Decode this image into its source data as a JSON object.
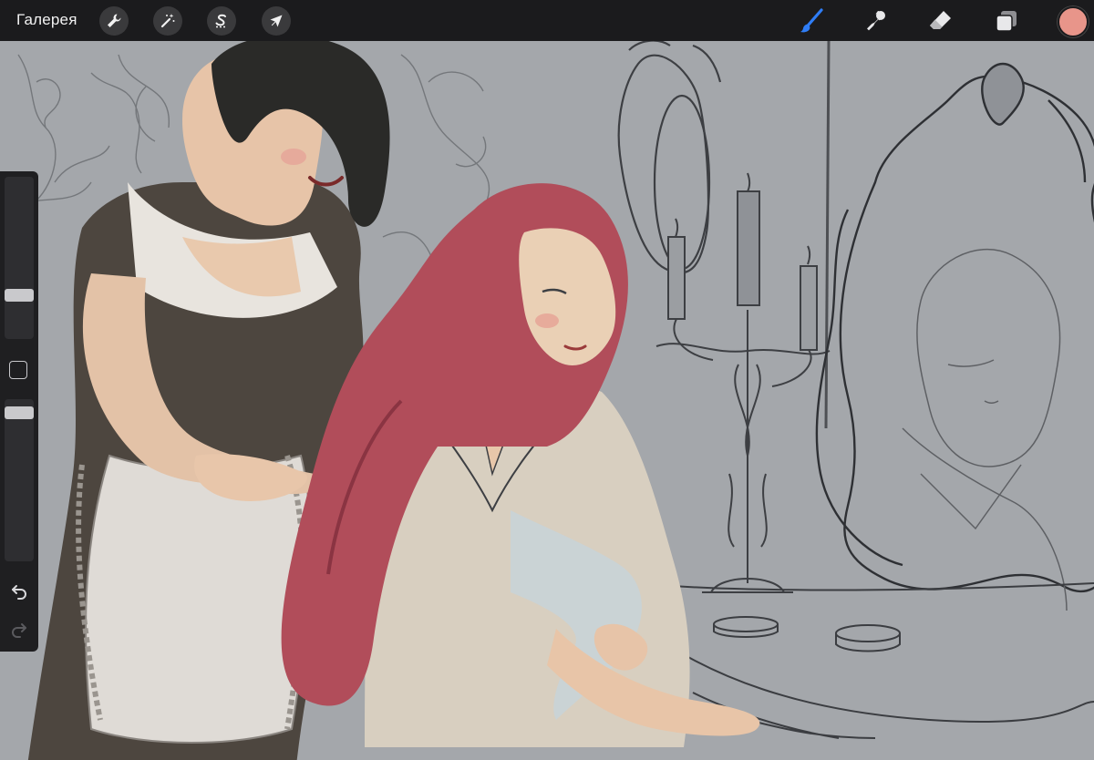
{
  "topbar": {
    "gallery_label": "Галерея",
    "left_tools": [
      {
        "name": "wrench-icon",
        "meaning": "actions"
      },
      {
        "name": "magic-wand-icon",
        "meaning": "adjustments"
      },
      {
        "name": "selection-s-icon",
        "meaning": "selection"
      },
      {
        "name": "arrow-cursor-icon",
        "meaning": "transform"
      }
    ],
    "right_tools": [
      {
        "name": "brush-icon",
        "active": true
      },
      {
        "name": "smudge-icon",
        "active": false
      },
      {
        "name": "eraser-icon",
        "active": false
      },
      {
        "name": "layers-icon",
        "active": false
      }
    ],
    "active_color": "#e8958a",
    "accent_color": "#2f7df6"
  },
  "sidebar": {
    "brush_size": 0.25,
    "opacity": 0.95
  },
  "canvas": {
    "background": "#a4a7ab"
  }
}
